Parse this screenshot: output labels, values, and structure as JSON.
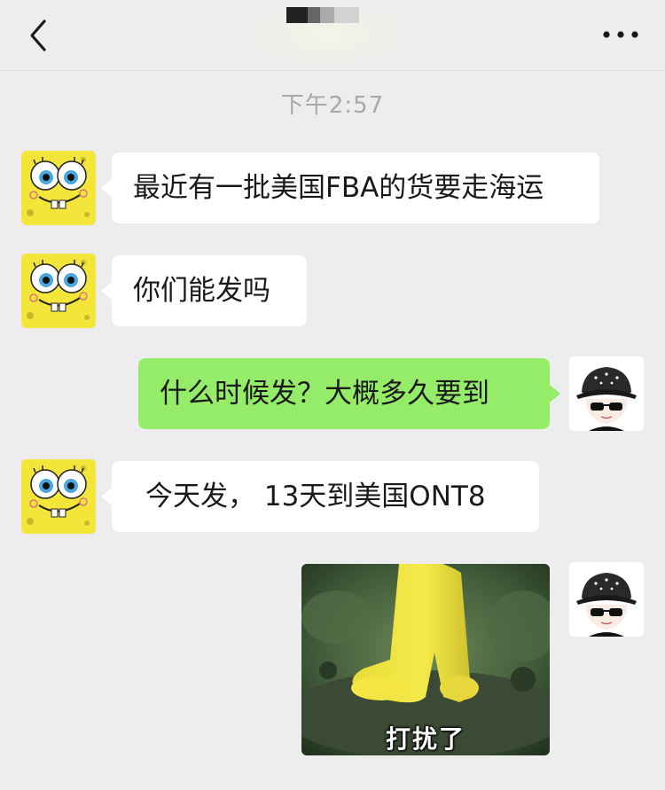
{
  "header": {
    "back_icon": "chevron-left-icon",
    "title": "",
    "more_icon": "ellipsis-icon"
  },
  "timestamp": "下午2:57",
  "messages": [
    {
      "side": "left",
      "text": "最近有一批美国FBA的货要走海运",
      "avatar": "spongebob-avatar"
    },
    {
      "side": "left",
      "text": "你们能发吗",
      "avatar": "spongebob-avatar"
    },
    {
      "side": "right",
      "text": "什么时候发？大概多久要到",
      "avatar": "cap-boy-avatar"
    },
    {
      "side": "left",
      "text": "今天发， 13天到美国ONT8",
      "avatar": "spongebob-avatar"
    },
    {
      "side": "right",
      "type": "sticker",
      "caption": "打扰了",
      "avatar": "cap-boy-avatar"
    }
  ],
  "colors": {
    "background": "#ededed",
    "incoming_bubble": "#ffffff",
    "outgoing_bubble": "#95ec69",
    "timestamp": "#a8a8a8"
  }
}
